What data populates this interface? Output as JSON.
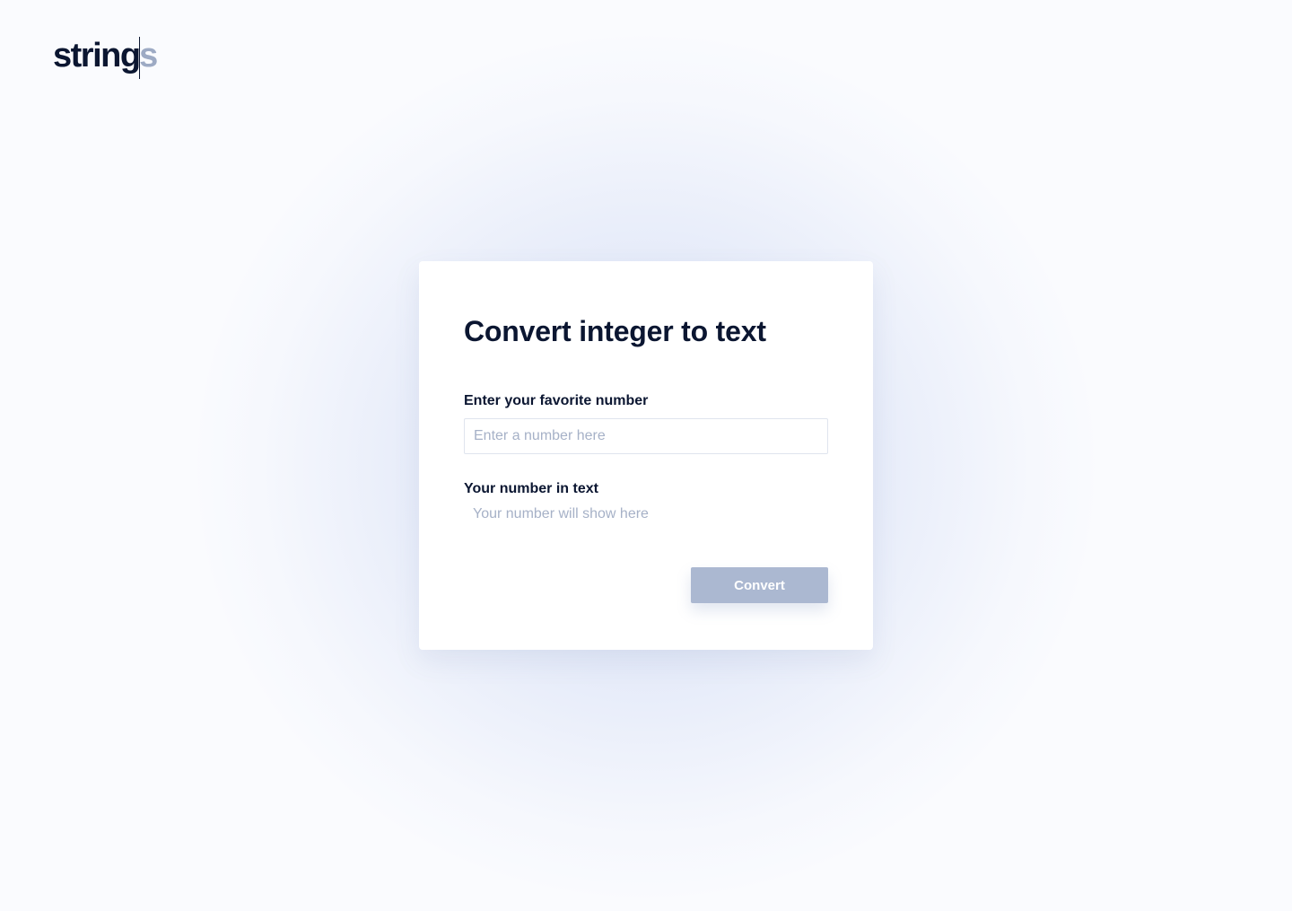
{
  "brand": {
    "logo_main": "string",
    "logo_tail": "s"
  },
  "card": {
    "title": "Convert integer to text",
    "number_label": "Enter your favorite number",
    "number_placeholder": "Enter a number here",
    "number_value": "",
    "result_label": "Your number in text",
    "result_placeholder": "Your number will show here",
    "convert_label": "Convert"
  },
  "colors": {
    "primary_text": "#0b1631",
    "muted_text": "#a6b1c7",
    "button_disabled": "#abb8d1",
    "background": "#fafbfe"
  }
}
